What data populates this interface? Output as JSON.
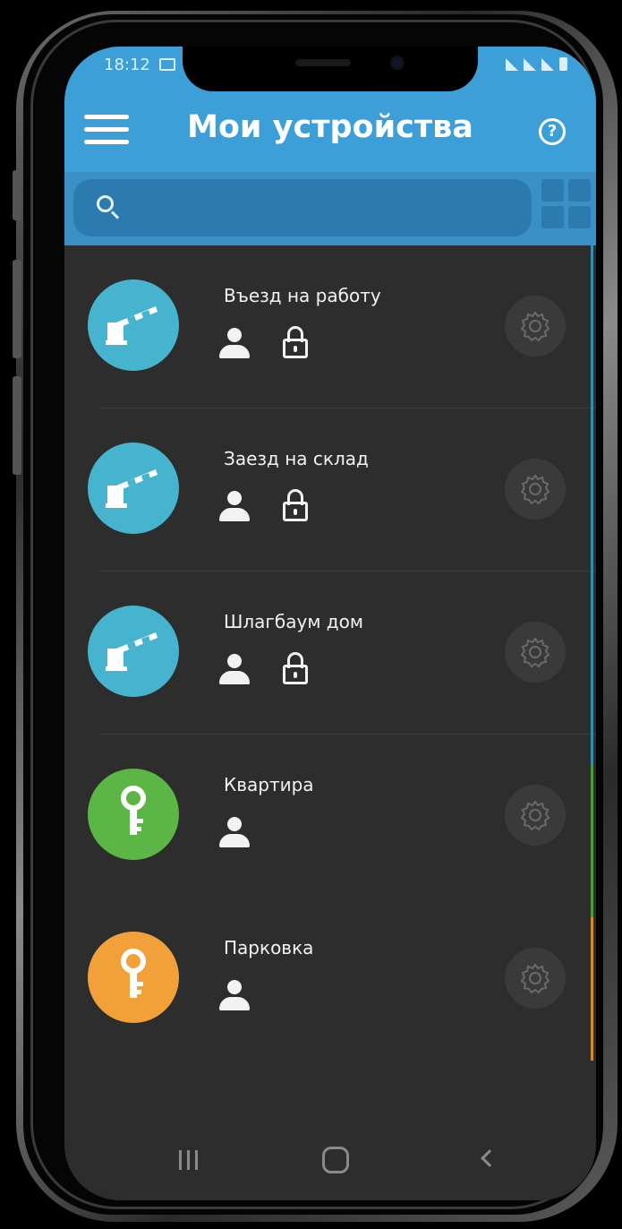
{
  "status_bar": {
    "time": "18:12"
  },
  "header": {
    "title": "Мои устройства",
    "menu_icon": "hamburger-icon",
    "help_icon": "help-circle-icon",
    "help_glyph": "?",
    "grid_icon": "grid-view-icon"
  },
  "search": {
    "placeholder": "",
    "value": ""
  },
  "devices": [
    {
      "name": "Въезд на работу",
      "icon": "barrier-gate-icon",
      "color": "#47b4cf",
      "has_lock": true
    },
    {
      "name": "Заезд на склад",
      "icon": "barrier-gate-icon",
      "color": "#47b4cf",
      "has_lock": true
    },
    {
      "name": "Шлагбаум дом",
      "icon": "barrier-gate-icon",
      "color": "#47b4cf",
      "has_lock": true
    },
    {
      "name": "Квартира",
      "icon": "key-icon",
      "color": "#5bb645",
      "has_lock": false
    },
    {
      "name": "Парковка",
      "icon": "key-icon",
      "color": "#f2a03a",
      "has_lock": false
    }
  ],
  "colors": {
    "header": "#3d9fd8",
    "background": "#2d2d2d",
    "barrier": "#47b4cf",
    "green": "#5bb645",
    "orange": "#f2a03a"
  }
}
